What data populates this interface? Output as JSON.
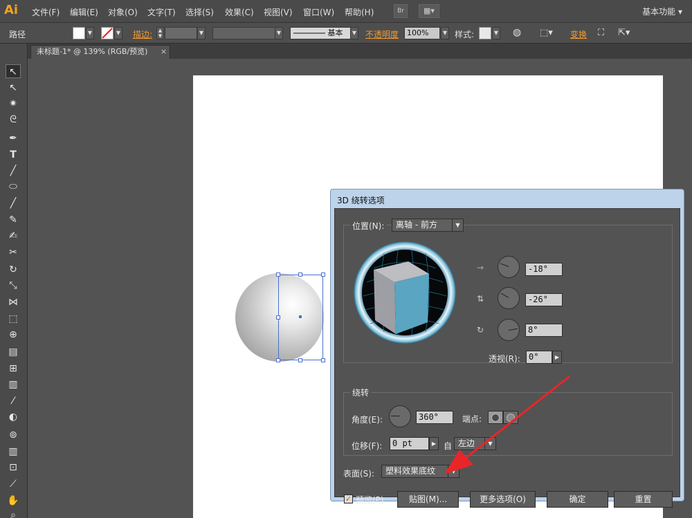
{
  "app": {
    "logo": "Ai",
    "workspace": "基本功能 ▾"
  },
  "menu": [
    "文件(F)",
    "编辑(E)",
    "对象(O)",
    "文字(T)",
    "选择(S)",
    "效果(C)",
    "视图(V)",
    "窗口(W)",
    "帮助(H)"
  ],
  "menu_buttons": {
    "bridge": "Br",
    "arrange": "▦▾"
  },
  "control": {
    "object_type": "路径",
    "stroke_label": "描边:",
    "stroke_style": "基本",
    "opacity_label": "不透明度",
    "opacity_value": "100%",
    "style_label": "样式:",
    "transform_label": "变换"
  },
  "document_tab": {
    "title": "未标题-1* @ 139% (RGB/预览)",
    "close": "×"
  },
  "tools": [
    "selection-tool",
    "direct-selection-tool",
    "magic-wand-tool",
    "lasso-tool",
    "pen-tool",
    "type-tool",
    "line-tool",
    "ellipse-tool",
    "paintbrush-tool",
    "pencil-tool",
    "blob-brush-tool",
    "scissors-tool",
    "rotate-tool",
    "scale-tool",
    "width-tool",
    "free-transform-tool",
    "shape-builder-tool",
    "perspective-grid-tool",
    "mesh-tool",
    "gradient-tool",
    "eyedropper-tool",
    "blend-tool",
    "symbol-sprayer-tool",
    "column-graph-tool",
    "artboard-tool",
    "slice-tool",
    "hand-tool",
    "zoom-tool"
  ],
  "dialog": {
    "title": "3D 绕转选项",
    "position": {
      "label": "位置(N):",
      "value": "离轴 - 前方"
    },
    "rotation": {
      "x": "-18°",
      "y": "-26°",
      "z": "8°"
    },
    "perspective": {
      "label": "透视(R):",
      "value": "0°"
    },
    "revolve": {
      "group_label": "绕转",
      "angle_label": "角度(E):",
      "angle_value": "360°",
      "cap_label": "端点:",
      "offset_label": "位移(F):",
      "offset_value": "0 pt",
      "from_label": "自",
      "from_value": "左边"
    },
    "surface": {
      "label": "表面(S):",
      "value": "塑料效果底纹"
    },
    "preview_label": "预览(P)",
    "buttons": {
      "map_art": "贴图(M)...",
      "more_options": "更多选项(O)",
      "ok": "确定",
      "reset": "重置"
    }
  },
  "colors": {
    "accent": "#f7a21b",
    "arrow": "#e8262a",
    "cube_front": "#5aa5c1"
  }
}
